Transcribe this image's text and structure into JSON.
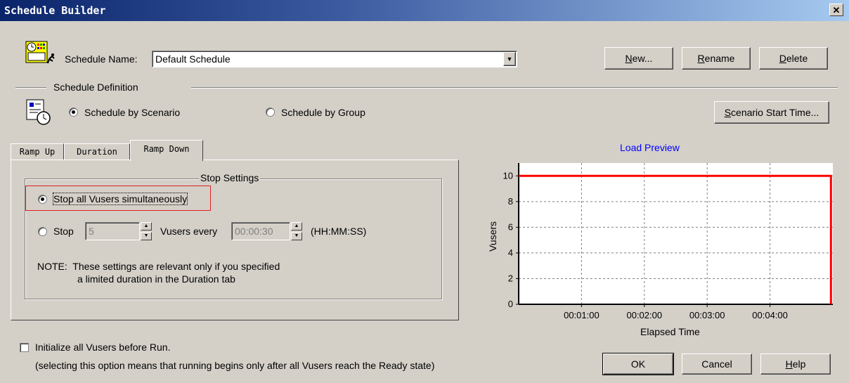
{
  "window": {
    "title": "Schedule Builder",
    "close_glyph": "✕"
  },
  "schedule_name": {
    "label": "Schedule Name:",
    "value": "Default Schedule"
  },
  "buttons": {
    "new": "New...",
    "rename": "Rename",
    "delete": "Delete",
    "scenario_start_time": "Scenario Start Time...",
    "ok": "OK",
    "cancel": "Cancel",
    "help": "Help"
  },
  "schedule_definition": {
    "label": "Schedule Definition",
    "by_scenario": "Schedule by Scenario",
    "by_group": "Schedule by Group",
    "selected": "by_scenario"
  },
  "tabs": [
    {
      "label": "Ramp Up"
    },
    {
      "label": "Duration"
    },
    {
      "label": "Ramp Down",
      "active": true
    }
  ],
  "stop_settings": {
    "title": "Stop Settings",
    "option_all": "Stop all Vusers simultaneously",
    "option_stop": "Stop",
    "count_value": "5",
    "vusers_every": "Vusers every",
    "interval_value": "00:00:30",
    "interval_format": "(HH:MM:SS)",
    "note_line1": "NOTE:  These settings are relevant only if you specified",
    "note_line2": "a limited duration in the Duration tab"
  },
  "initialize": {
    "label": "Initialize all Vusers before Run.",
    "note": "(selecting this option means that running begins only after all Vusers reach the Ready state)"
  },
  "chart_data": {
    "type": "line",
    "title": "Load Preview",
    "xlabel": "Elapsed Time",
    "ylabel": "Vusers",
    "x_ticks": [
      "00:01:00",
      "00:02:00",
      "00:03:00",
      "00:04:00"
    ],
    "y_ticks": [
      "0",
      "2",
      "4",
      "6",
      "8",
      "10"
    ],
    "ylim": [
      0,
      11
    ],
    "xlim_minutes": [
      0,
      5
    ],
    "series": [
      {
        "x_minutes": [
          0,
          4.97,
          4.97
        ],
        "y": [
          10,
          10,
          0
        ]
      }
    ],
    "grid": true,
    "line_color": "#ff0000",
    "title_color": "#0000ff",
    "highlight_color": "#e02020"
  }
}
